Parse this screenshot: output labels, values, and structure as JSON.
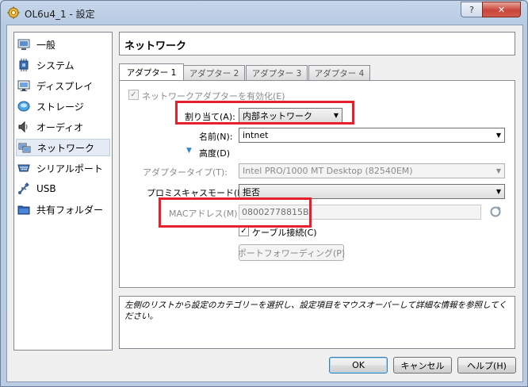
{
  "window": {
    "title": "OL6u4_1 - 設定",
    "help_button": "?",
    "close_button": "✕"
  },
  "sidebar": {
    "items": [
      {
        "label": "一般",
        "icon": "general-icon"
      },
      {
        "label": "システム",
        "icon": "system-chip-icon"
      },
      {
        "label": "ディスプレイ",
        "icon": "display-icon"
      },
      {
        "label": "ストレージ",
        "icon": "storage-disk-icon"
      },
      {
        "label": "オーディオ",
        "icon": "speaker-icon"
      },
      {
        "label": "ネットワーク",
        "icon": "network-icon"
      },
      {
        "label": "シリアルポート",
        "icon": "serial-port-icon"
      },
      {
        "label": "USB",
        "icon": "usb-icon"
      },
      {
        "label": "共有フォルダー",
        "icon": "shared-folder-icon"
      }
    ],
    "selected": "ネットワーク"
  },
  "header": {
    "title": "ネットワーク"
  },
  "tabs": [
    {
      "label": "アダプター 1",
      "active": true
    },
    {
      "label": "アダプター 2",
      "active": false
    },
    {
      "label": "アダプター 3",
      "active": false
    },
    {
      "label": "アダプター 4",
      "active": false
    }
  ],
  "adapter": {
    "enable_label": "ネットワークアダプターを有効化(E)",
    "enable_checked": true,
    "attached_label": "割り当て(A):",
    "attached_value": "内部ネットワーク",
    "name_label": "名前(N):",
    "name_value": "intnet",
    "advanced_label": "高度(D)",
    "type_label": "アダプタータイプ(T):",
    "type_value": "Intel PRO/1000 MT Desktop (82540EM)",
    "promisc_label": "プロミスキャスモード(P):",
    "promisc_value": "拒否",
    "mac_label": "MACアドレス(M):",
    "mac_value": "08002778815B",
    "cable_label": "ケーブル接続(C)",
    "cable_checked": true,
    "port_forward_label": "ポートフォワーディング(P)"
  },
  "help_text": "左側のリストから設定のカテゴリーを選択し、設定項目をマウスオーバーして詳細な情報を参照してください。",
  "buttons": {
    "ok": "OK",
    "cancel": "キャンセル",
    "help": "ヘルプ(H)"
  },
  "colors": {
    "highlight": "#e8202e",
    "selection": "#e4ebf5"
  }
}
